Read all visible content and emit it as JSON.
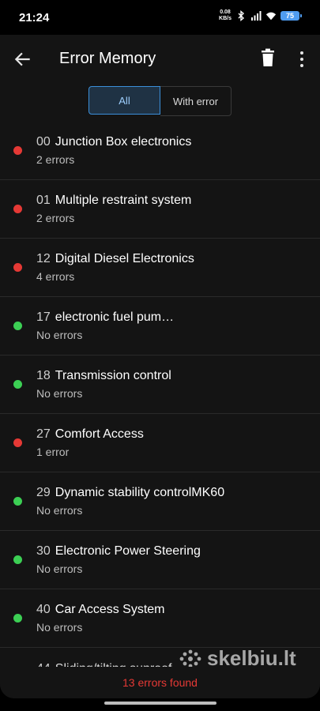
{
  "status_bar": {
    "time": "21:24",
    "net_speed_value": "0.08",
    "net_speed_unit": "KB/s",
    "battery": "75"
  },
  "app_bar": {
    "title": "Error Memory",
    "back_icon": "arrow-left-icon",
    "delete_icon": "trash-icon",
    "more_icon": "more-vertical-icon"
  },
  "filter": {
    "all_label": "All",
    "with_error_label": "With error",
    "selected": "All"
  },
  "modules": [
    {
      "code": "00",
      "name": "Junction Box electronics",
      "status": "2 errors",
      "state": "error"
    },
    {
      "code": "01",
      "name": "Multiple restraint system",
      "status": "2 errors",
      "state": "error"
    },
    {
      "code": "12",
      "name": "Digital Diesel Electronics",
      "status": "4 errors",
      "state": "error"
    },
    {
      "code": "17",
      "name": "electronic fuel pum…",
      "status": "No errors",
      "state": "ok"
    },
    {
      "code": "18",
      "name": "Transmission control",
      "status": "No errors",
      "state": "ok"
    },
    {
      "code": "27",
      "name": "Comfort Access",
      "status": "1 error",
      "state": "error"
    },
    {
      "code": "29",
      "name": "Dynamic stability controlMK60",
      "status": "No errors",
      "state": "ok"
    },
    {
      "code": "30",
      "name": "Electronic Power Steering",
      "status": "No errors",
      "state": "ok"
    },
    {
      "code": "40",
      "name": "Car Access System",
      "status": "No errors",
      "state": "ok"
    },
    {
      "code": "44",
      "name": "Sliding/tilting sunroof",
      "status": "",
      "state": "partial"
    }
  ],
  "footer": {
    "summary": "13 errors found"
  },
  "watermark": {
    "text": "skelbiu.lt"
  },
  "colors": {
    "error": "#e53935",
    "ok": "#3ccf54",
    "accent": "#3b8fd9"
  }
}
